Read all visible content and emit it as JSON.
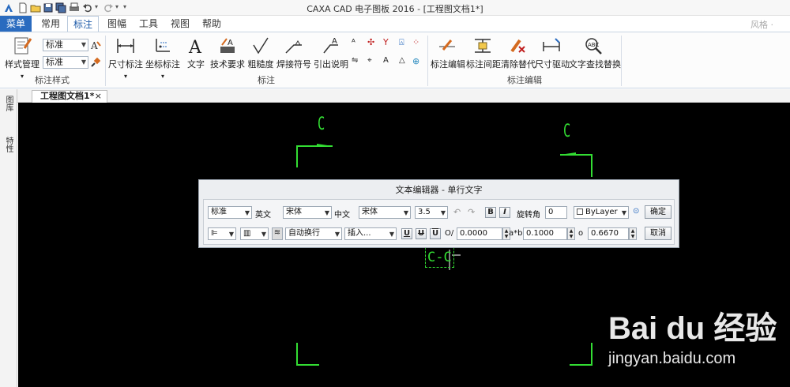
{
  "titlebar": {
    "title": "CAXA CAD 电子图板 2016 - [工程图文档1*]"
  },
  "tabs": [
    {
      "label": "菜单"
    },
    {
      "label": "常用"
    },
    {
      "label": "标注"
    },
    {
      "label": "图幅"
    },
    {
      "label": "工具"
    },
    {
      "label": "视图"
    },
    {
      "label": "帮助"
    }
  ],
  "user": "风格 ·",
  "ribbon": {
    "style_group": {
      "button": "样式管理",
      "combo1": "标准",
      "combo2": "标准",
      "label": "标注样式"
    },
    "annotate_group": {
      "buttons": [
        "尺寸标注",
        "坐标标注",
        "文字",
        "技术要求",
        "粗糙度",
        "焊接符号",
        "引出说明"
      ],
      "label": "标注"
    },
    "edit_group": {
      "buttons": [
        "标注编辑",
        "标注间距",
        "清除替代",
        "尺寸驱动",
        "文字查找替换"
      ],
      "label": "标注编辑"
    }
  },
  "doc_tab": {
    "label": "工程图文档1*",
    "close": "×"
  },
  "side_tabs": [
    "图库",
    "特性"
  ],
  "canvas": {
    "letters": [
      "C",
      "C"
    ],
    "edit_text": "C-C"
  },
  "dialog": {
    "title": "文本编辑器 - 单行文字",
    "row1": {
      "style": "标准",
      "en_label": "英文",
      "en_font": "宋体",
      "cn_label": "中文",
      "cn_font": "宋体",
      "height": "3.5",
      "bold": "B",
      "italic": "I",
      "rotate_label": "旋转角",
      "rotate": "0",
      "layer": "ByLayer",
      "ok": "确定"
    },
    "row2": {
      "wrap": "自动换行",
      "insert": "插入...",
      "u1": "U",
      "u2": "U",
      "u3": "U",
      "oblique_label": "O/",
      "oblique": "0.0000",
      "spacing_label": "a*b",
      "spacing": "0.1000",
      "ratio_label": "o",
      "ratio": "0.6670",
      "cancel": "取消"
    }
  },
  "watermark": {
    "main": "Bai du 经验",
    "url": "jingyan.baidu.com"
  }
}
